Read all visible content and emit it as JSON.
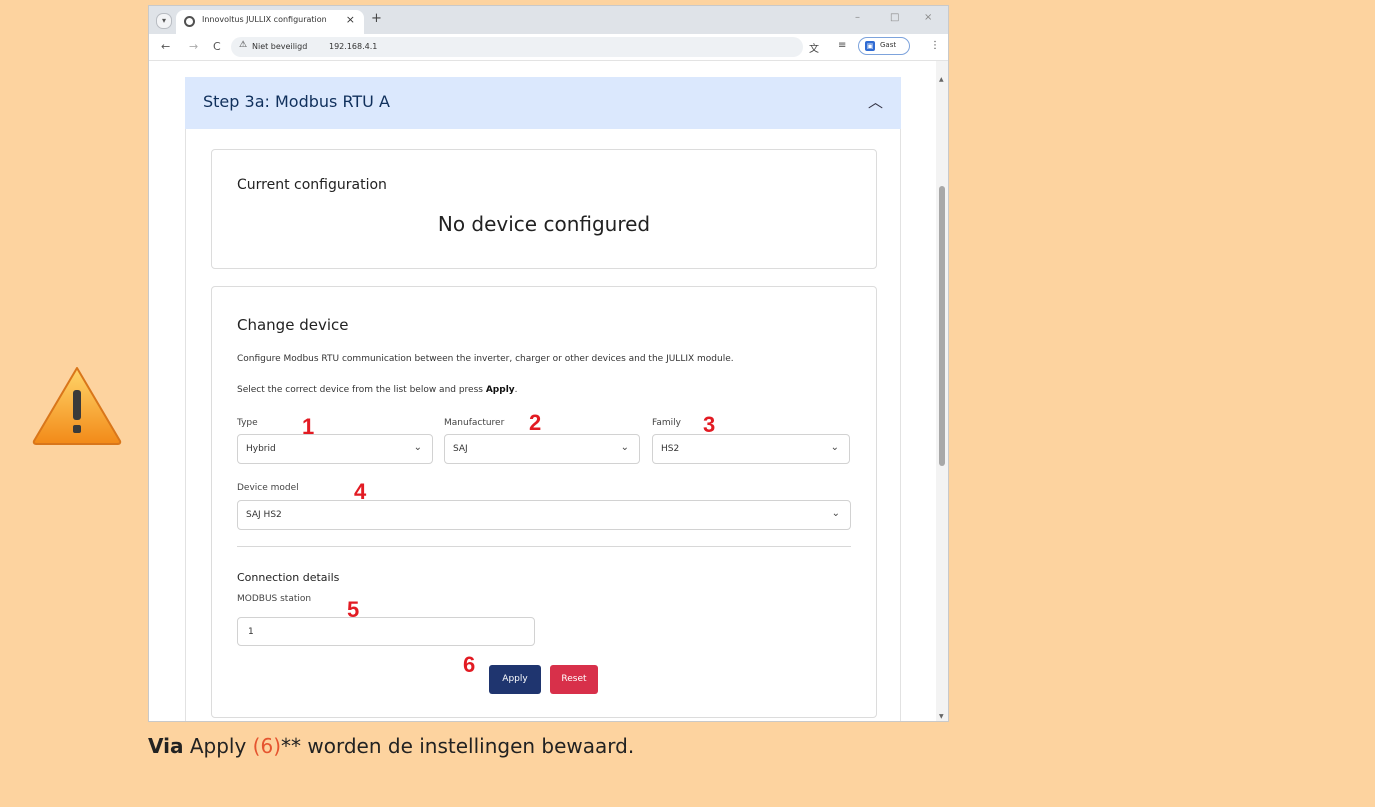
{
  "warning": {
    "icon": "warning-icon"
  },
  "browser": {
    "tab_title": "Innovoltus JULLIX configuration",
    "tab_close": "×",
    "new_tab": "+",
    "window_controls": {
      "minimize": "–",
      "maximize": "□",
      "close": "×"
    },
    "nav": {
      "back": "←",
      "forward": "→",
      "reload": "C"
    },
    "omnibox": {
      "security_status": "Niet beveiligd",
      "url": "192.168.4.1"
    },
    "profile": {
      "label": "Gast"
    },
    "menu": "⋮"
  },
  "page": {
    "accordion": {
      "title": "Step 3a: Modbus RTU A"
    },
    "current": {
      "title": "Current configuration",
      "value": "No device configured"
    },
    "change": {
      "title": "Change device",
      "description": "Configure Modbus RTU communication between the inverter, charger or other devices and the JULLIX module.",
      "instruction_prefix": "Select the correct device from the list below and press ",
      "instruction_bold": "Apply",
      "instruction_suffix": ".",
      "type": {
        "label": "Type",
        "value": "Hybrid"
      },
      "manufacturer": {
        "label": "Manufacturer",
        "value": "SAJ"
      },
      "family": {
        "label": "Family",
        "value": "HS2"
      },
      "device_model": {
        "label": "Device model",
        "value": "SAJ HS2"
      },
      "connection": {
        "title": "Connection details",
        "station_label": "MODBUS station",
        "station_value": "1"
      },
      "apply_label": "Apply",
      "reset_label": "Reset"
    },
    "markers": [
      "1",
      "2",
      "3",
      "4",
      "5",
      "6"
    ]
  },
  "caption": {
    "bold": "Via",
    "text1": " Apply ",
    "ref": "(6)",
    "text2": "** worden de instellingen bewaard."
  }
}
